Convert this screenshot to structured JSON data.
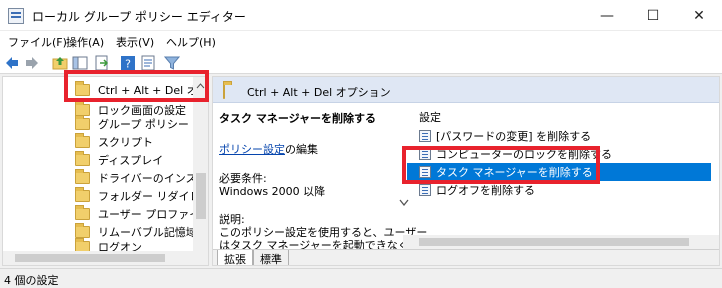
{
  "window": {
    "title": "ローカル グループ ポリシー エディター",
    "minimize_glyph": "—",
    "maximize_glyph": "☐",
    "close_glyph": "✕"
  },
  "menu": [
    "ファイル(F)",
    "操作(A)",
    "表示(V)",
    "ヘルプ(H)"
  ],
  "toolbar_icons": [
    "back-arrow-icon",
    "forward-arrow-icon",
    "folder-up-icon",
    "show-hide-tree-icon",
    "export-list-icon",
    "help-icon",
    "properties-icon",
    "filter-icon"
  ],
  "tree": {
    "items": [
      "Ctrl + Alt + Del オプション",
      "ロック画面の設定",
      "グループ ポリシー",
      "スクリプト",
      "ディスプレイ",
      "ドライバーのインストール",
      "フォルダー リダイレクト",
      "ユーザー プロファイル",
      "リムーバブル記憶域へのアクセス",
      "ログオン"
    ]
  },
  "right_pane": {
    "header": "Ctrl + Alt + Del オプション",
    "desc": {
      "title": "タスク マネージャーを削除する",
      "policy_link": "ポリシー設定",
      "policy_link_suffix": "の編集",
      "requirements_label": "必要条件:",
      "requirements_value": "Windows 2000 以降",
      "explanation_label": "説明:",
      "explanation_line1": "このポリシー設定を使用すると、ユーザー",
      "explanation_line2": "はタスク マネージャーを起動できなくなり"
    },
    "list": {
      "column_header": "設定",
      "rows": [
        "[パスワードの変更] を削除する",
        "コンピューターのロックを削除する",
        "タスク マネージャーを削除する",
        "ログオフを削除する"
      ],
      "selected_index": 2
    },
    "tabs": [
      "拡張",
      "標準"
    ]
  },
  "statusbar": {
    "text": "4 個の設定"
  },
  "colors": {
    "selection": "#0078d7",
    "highlight_box": "#e8222d",
    "header_bg": "#dfe7f4"
  }
}
